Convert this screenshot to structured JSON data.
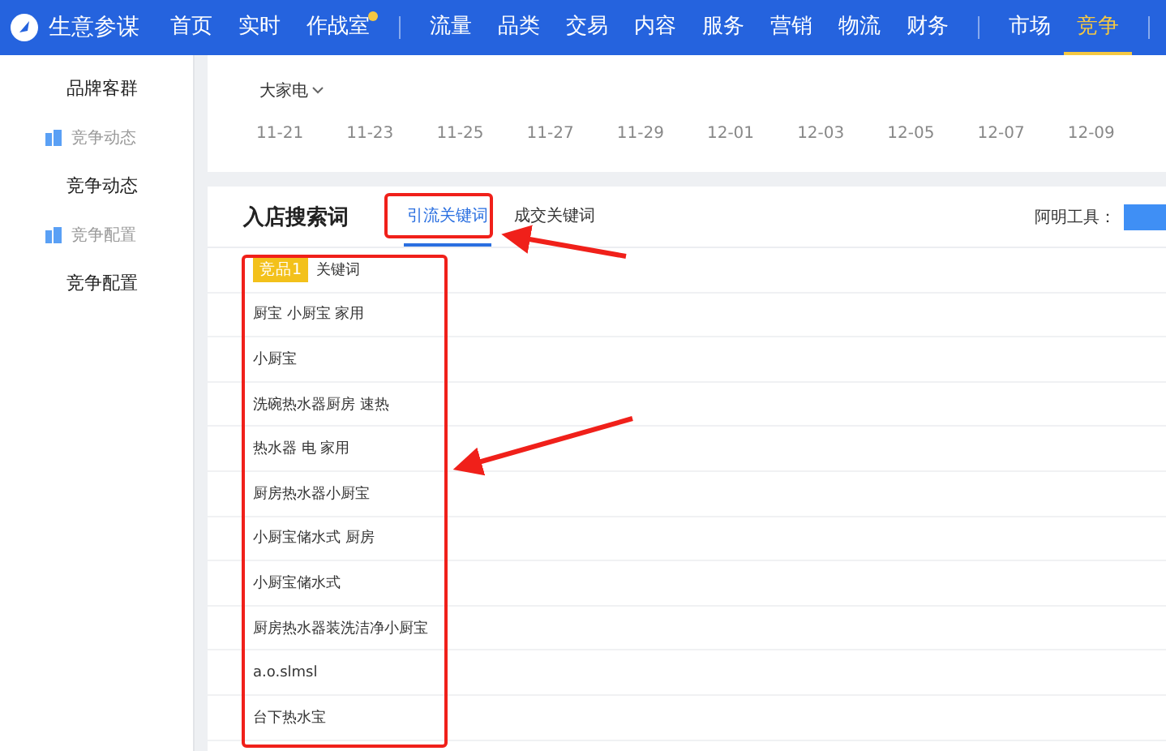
{
  "topbar": {
    "logo": "生意参谋",
    "nav_groups": [
      [
        {
          "label": "首页",
          "selected": false,
          "badge": false
        },
        {
          "label": "实时",
          "selected": false,
          "badge": false
        },
        {
          "label": "作战室",
          "selected": false,
          "badge": true
        }
      ],
      [
        {
          "label": "流量",
          "selected": false,
          "badge": false
        },
        {
          "label": "品类",
          "selected": false,
          "badge": false
        },
        {
          "label": "交易",
          "selected": false,
          "badge": false
        },
        {
          "label": "内容",
          "selected": false,
          "badge": false
        },
        {
          "label": "服务",
          "selected": false,
          "badge": false
        },
        {
          "label": "营销",
          "selected": false,
          "badge": false
        },
        {
          "label": "物流",
          "selected": false,
          "badge": false
        },
        {
          "label": "财务",
          "selected": false,
          "badge": false
        }
      ],
      [
        {
          "label": "市场",
          "selected": false,
          "badge": false
        },
        {
          "label": "竞争",
          "selected": true,
          "badge": false
        }
      ]
    ]
  },
  "sidebar": {
    "items": [
      {
        "kind": "item",
        "label": "品牌客群"
      },
      {
        "kind": "group",
        "label": "竞争动态"
      },
      {
        "kind": "item",
        "label": "竞争动态"
      },
      {
        "kind": "group",
        "label": "竞争配置"
      },
      {
        "kind": "item",
        "label": "竞争配置"
      }
    ]
  },
  "trend_card": {
    "category_dropdown": "大家电",
    "x_axis_labels": [
      "11-21",
      "11-23",
      "11-25",
      "11-27",
      "11-29",
      "12-01",
      "12-03",
      "12-05",
      "12-07",
      "12-09"
    ]
  },
  "search_words": {
    "title": "入店搜索词",
    "tabs": [
      {
        "label": "引流关键词",
        "selected": true
      },
      {
        "label": "成交关键词",
        "selected": false
      }
    ],
    "tool_label": "阿明工具：",
    "table": {
      "badge": "竞品1",
      "column": "关键词",
      "rows": [
        "厨宝 小厨宝 家用",
        "小厨宝",
        "洗碗热水器厨房 速热",
        "热水器 电 家用",
        "厨房热水器小厨宝",
        "小厨宝储水式 厨房",
        "小厨宝储水式",
        "厨房热水器装洗洁净小厨宝",
        "a.o.slmsl",
        "台下热水宝"
      ]
    }
  }
}
